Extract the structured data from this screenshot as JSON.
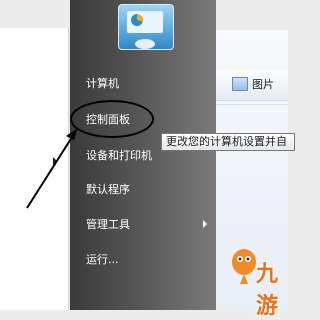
{
  "start_menu": {
    "items": [
      {
        "label": "计算机"
      },
      {
        "label": "控制面板"
      },
      {
        "label": "设备和打印机"
      },
      {
        "label": "默认程序"
      },
      {
        "label": "管理工具"
      },
      {
        "label": "运行..."
      }
    ]
  },
  "tooltip": {
    "text": "更改您的计算机设置并自"
  },
  "explorer": {
    "pictures_label": "图片"
  },
  "watermark": {
    "text": "九游"
  },
  "icons": {
    "user_picture": "control-panel-picture-icon",
    "submenu": "chevron-right-icon",
    "pictures": "pictures-folder-icon"
  }
}
